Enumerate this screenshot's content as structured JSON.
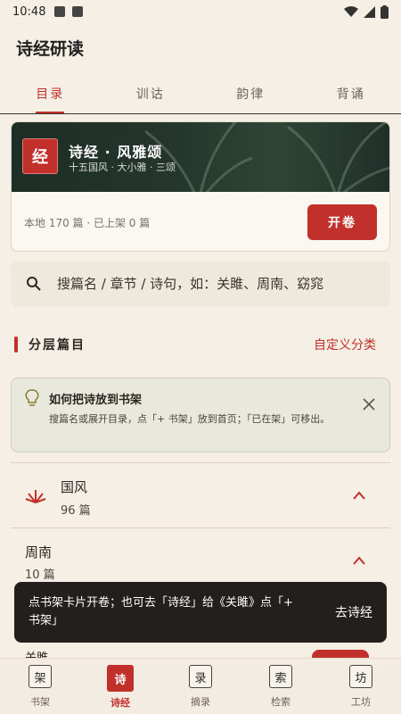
{
  "status": {
    "time": "10:48"
  },
  "app": {
    "title": "诗经研读"
  },
  "tabs": [
    {
      "label": "目录",
      "active": true
    },
    {
      "label": "训诂",
      "active": false
    },
    {
      "label": "韵律",
      "active": false
    },
    {
      "label": "背诵",
      "active": false
    }
  ],
  "banner": {
    "seal": "经",
    "title": "诗经 · 风雅颂",
    "subtitle": "十五国风 · 大小雅 · 三颂",
    "count_text": "本地 170 篇 · 已上架 0 篇",
    "open_label": "开卷"
  },
  "search": {
    "placeholder": "搜篇名 / 章节 / 诗句，如：关雎、周南、窈窕"
  },
  "section": {
    "title": "分层篇目",
    "custom_label": "自定义分类"
  },
  "tip": {
    "title": "如何把诗放到书架",
    "body": "搜篇名或展开目录，点「+ 书架」放到首页；「已在架」可移出。"
  },
  "groups": [
    {
      "name": "国风",
      "count": "96 篇"
    },
    {
      "name": "周南",
      "count": "10 篇"
    }
  ],
  "peek": {
    "label": "关雎"
  },
  "snackbar": {
    "message": "点书架卡片开卷；也可去「诗经」给《关雎》点「+ 书架」",
    "action": "去诗经"
  },
  "nav": [
    {
      "glyph": "架",
      "label": "书架",
      "active": false
    },
    {
      "glyph": "诗",
      "label": "诗经",
      "active": true
    },
    {
      "glyph": "录",
      "label": "摘录",
      "active": false
    },
    {
      "glyph": "索",
      "label": "检索",
      "active": false
    },
    {
      "glyph": "坊",
      "label": "工坊",
      "active": false
    }
  ],
  "colors": {
    "accent": "#c1302a",
    "background": "#f5efe6",
    "snackbar": "#221f1c"
  }
}
